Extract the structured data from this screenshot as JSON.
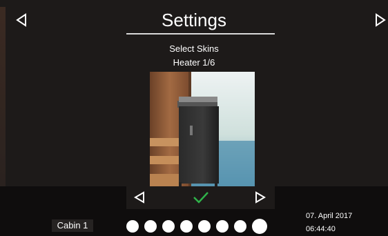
{
  "header": {
    "title": "Settings",
    "subtitle": "Select Skins",
    "selection": "Heater 1/6",
    "left_icon": "triangle-left-icon",
    "right_icon": "triangle-right-icon"
  },
  "preview": {
    "content": "sauna heater skin preview"
  },
  "controls": {
    "prev_icon": "triangle-left-icon",
    "confirm_icon": "check-icon",
    "next_icon": "triangle-right-icon",
    "confirm_color": "#2fb34a"
  },
  "footer": {
    "cabin_label": "Cabin 1",
    "dots_total": 8,
    "dots_active_index": 7,
    "date": "07. April 2017",
    "time": "06:44:40"
  }
}
